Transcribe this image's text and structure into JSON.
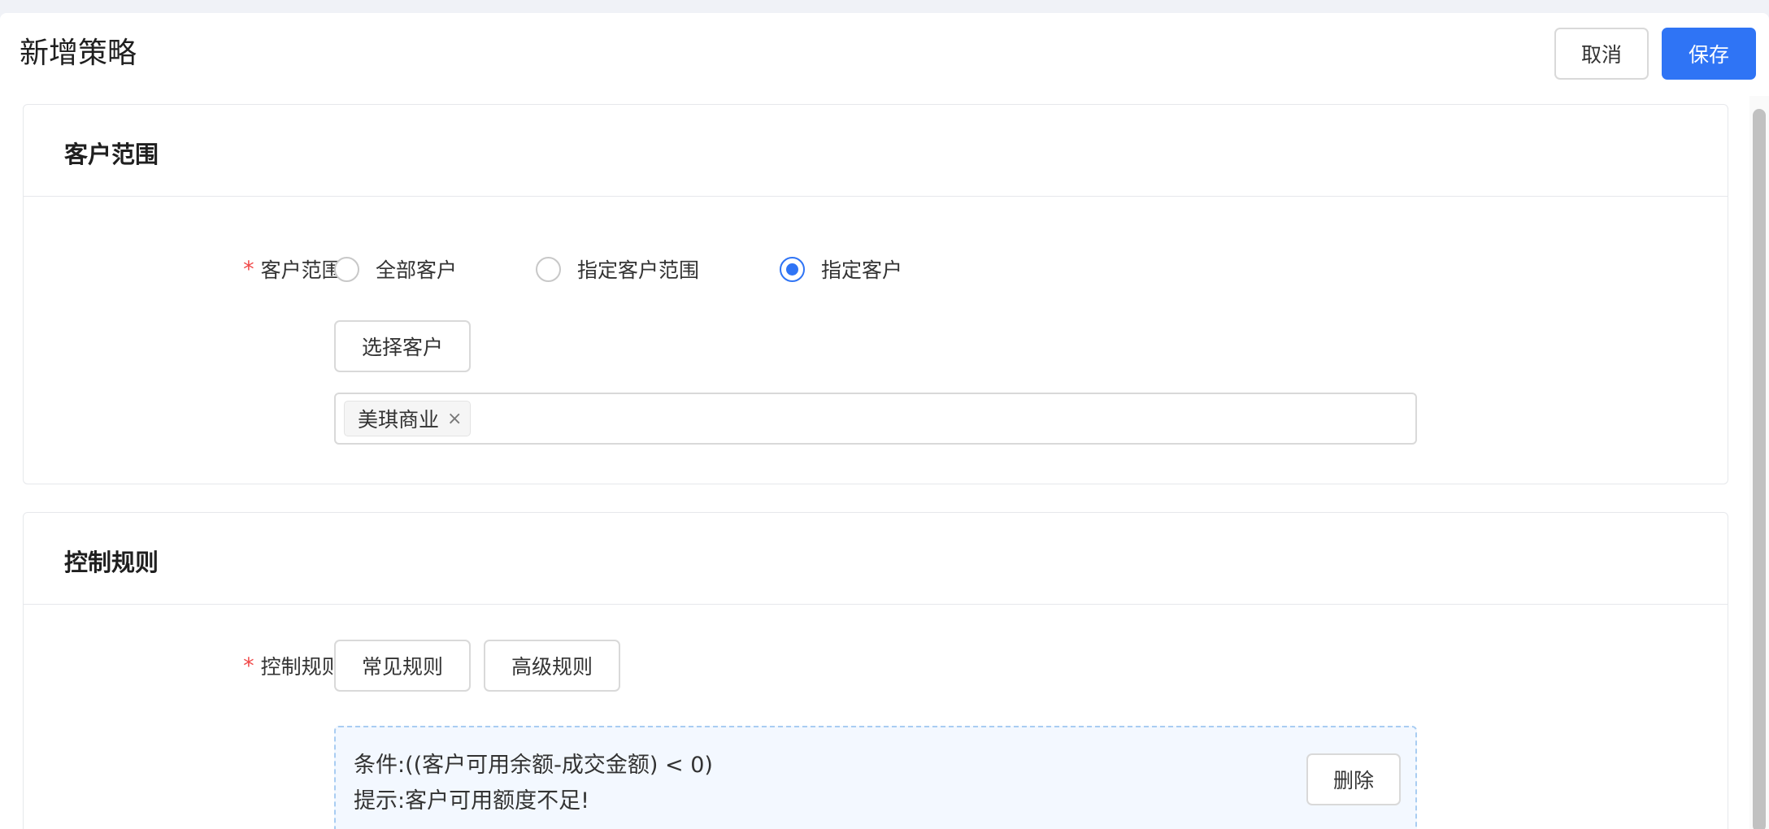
{
  "header": {
    "title": "新增策略",
    "cancel_label": "取消",
    "save_label": "保存"
  },
  "customer_section": {
    "title": "客户范围",
    "field_required_mark": "*",
    "field_label": "客户范围:",
    "radio_options": [
      {
        "label": "全部客户",
        "checked": false
      },
      {
        "label": "指定客户范围",
        "checked": false
      },
      {
        "label": "指定客户",
        "checked": true
      }
    ],
    "select_button_label": "选择客户",
    "selected_tags": [
      {
        "label": "美琪商业",
        "close": "×"
      }
    ]
  },
  "rule_section": {
    "title": "控制规则",
    "field_required_mark": "*",
    "field_label": "控制规则:",
    "common_rules_label": "常见规则",
    "advanced_rules_label": "高级规则",
    "rules": [
      {
        "condition": "条件:((客户可用余额-成交金额) < 0)",
        "hint": "提示:客户可用额度不足!",
        "delete_label": "删除"
      }
    ]
  },
  "colors": {
    "primary": "#2f74f5",
    "required": "#f04a4a",
    "rule_bg": "#f3f8ff",
    "rule_border": "#a9cdf2"
  }
}
